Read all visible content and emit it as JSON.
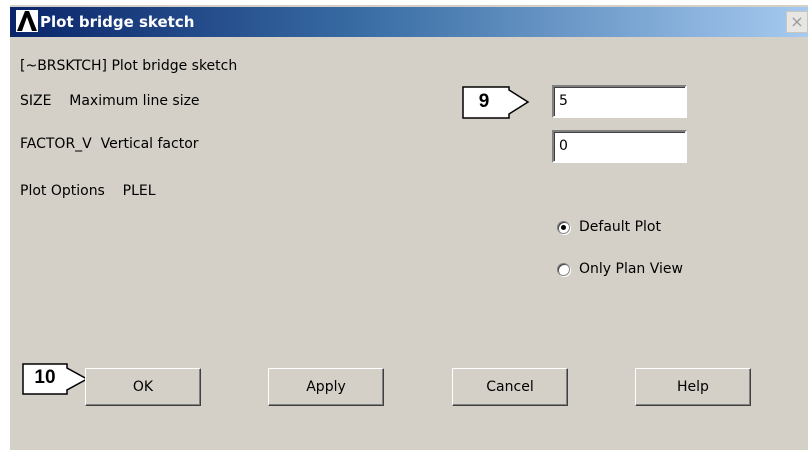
{
  "window": {
    "title": "Plot bridge sketch",
    "close_glyph": "×",
    "logo_icon": "ansys-logo-icon"
  },
  "form": {
    "command_label": "[~BRSKTCH] Plot bridge sketch",
    "size_label": "SIZE    Maximum line size",
    "factor_label": "FACTOR_V  Vertical factor",
    "plot_options_label": "Plot Options    PLEL",
    "size_value": "5",
    "factor_value": "0"
  },
  "plot_options": [
    {
      "label": "Default Plot",
      "checked": true
    },
    {
      "label": "Only Plan View",
      "checked": false
    }
  ],
  "buttons": {
    "ok": "OK",
    "apply": "Apply",
    "cancel": "Cancel",
    "help": "Help"
  },
  "callouts": {
    "size_field": "9",
    "ok_button": "10"
  }
}
